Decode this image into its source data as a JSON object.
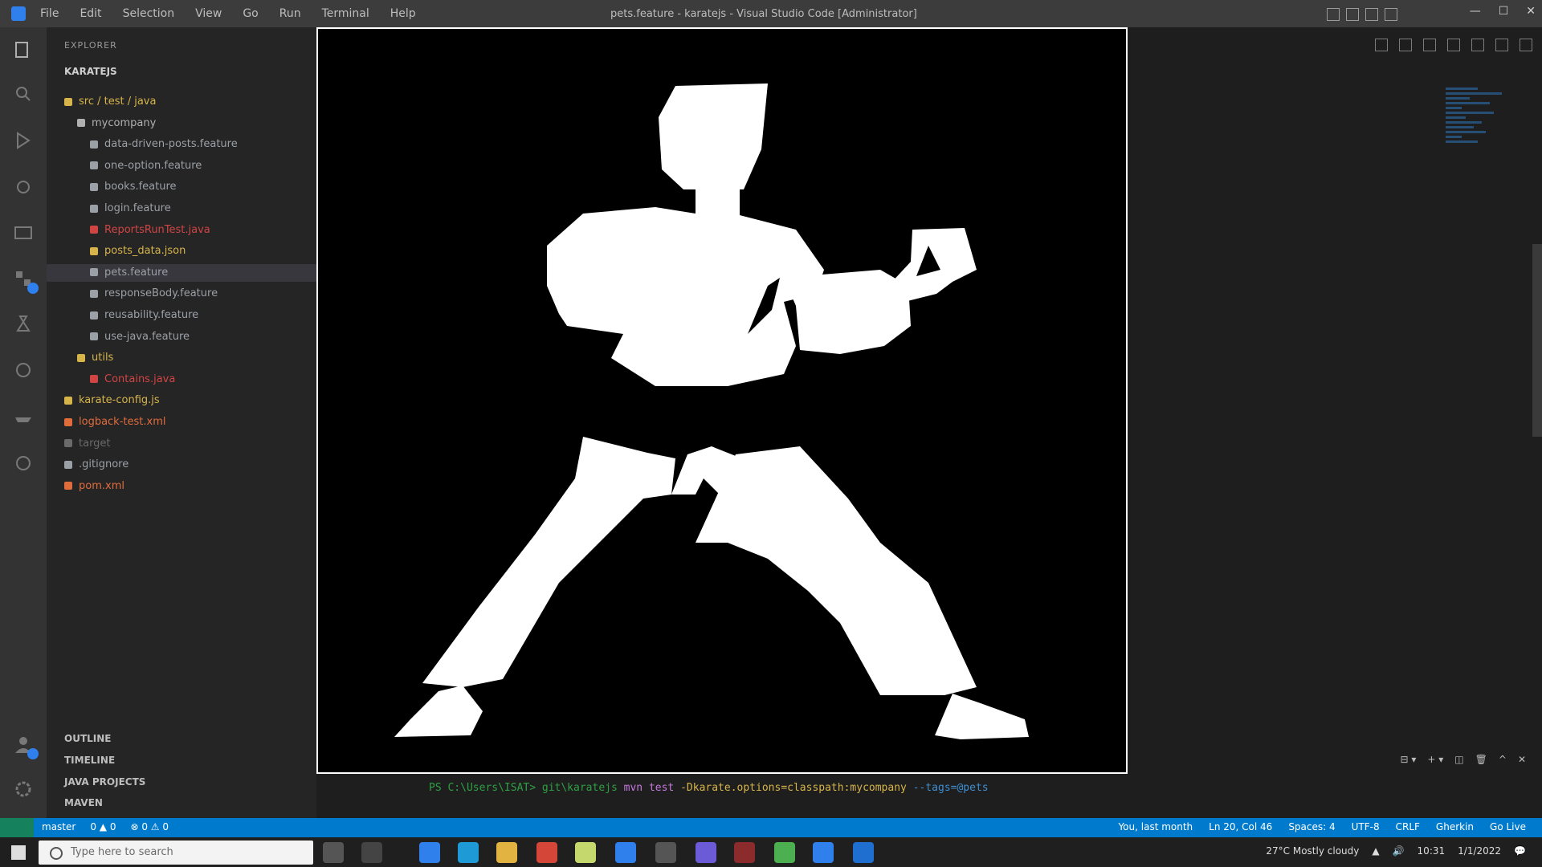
{
  "titlebar": {
    "title": "pets.feature - karatejs - Visual Studio Code [Administrator]",
    "menu": [
      "File",
      "Edit",
      "Selection",
      "View",
      "Go",
      "Run",
      "Terminal",
      "Help"
    ]
  },
  "explorer": {
    "section_title": "EXPLORER",
    "root": "KARATEJS",
    "items": [
      {
        "label": "src / test / java",
        "color": "#d6b44a"
      },
      {
        "label": "mycompany",
        "color": "#b0b0b0"
      },
      {
        "label": "data-driven-posts.feature",
        "color": "#9aa0a6"
      },
      {
        "label": "one-option.feature",
        "color": "#9aa0a6"
      },
      {
        "label": "books.feature",
        "color": "#9aa0a6"
      },
      {
        "label": "login.feature",
        "color": "#9aa0a6"
      },
      {
        "label": "ReportsRunTest.java",
        "color": "#d04444"
      },
      {
        "label": "posts_data.json",
        "color": "#d6b44a"
      },
      {
        "label": "pets.feature",
        "color": "#9aa0a6"
      },
      {
        "label": "responseBody.feature",
        "color": "#9aa0a6"
      },
      {
        "label": "reusability.feature",
        "color": "#9aa0a6"
      },
      {
        "label": "use-java.feature",
        "color": "#9aa0a6"
      },
      {
        "label": "utils",
        "color": "#d6b44a"
      },
      {
        "label": "Contains.java",
        "color": "#d04444"
      },
      {
        "label": "karate-config.js",
        "color": "#d6b44a"
      },
      {
        "label": "logback-test.xml",
        "color": "#e06c3c"
      },
      {
        "label": "target",
        "color": "#6a6a6a"
      },
      {
        "label": ".gitignore",
        "color": "#9aa0a6"
      },
      {
        "label": "pom.xml",
        "color": "#e06c3c"
      }
    ],
    "bottom_sections": [
      "OUTLINE",
      "TIMELINE",
      "JAVA PROJECTS",
      "MAVEN"
    ]
  },
  "terminal": {
    "prompt": "PS C:\\Users\\ISAT> git\\karatejs",
    "command": "mvn test",
    "args": "-Dkarate.options=classpath:mycompany",
    "output": "--tags=@pets"
  },
  "statusbar": {
    "left": [
      "master",
      "0 ▲ 0",
      "⊗ 0 ⚠ 0"
    ],
    "right": [
      "You, last month",
      "Ln 20, Col 46",
      "Spaces: 4",
      "UTF-8",
      "CRLF",
      "Gherkin",
      "Go Live"
    ]
  },
  "taskbar": {
    "search_placeholder": "Type here to search",
    "weather": "27°C Mostly cloudy",
    "time": "10:31",
    "date": "1/1/2022"
  },
  "image": {
    "description_icon": "karate-figure-icon",
    "colors": {
      "background": "#000000",
      "figure": "#ffffff"
    }
  }
}
